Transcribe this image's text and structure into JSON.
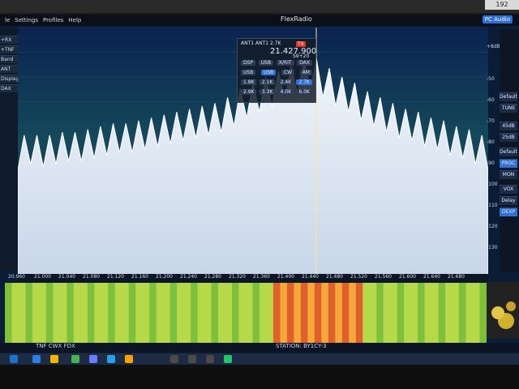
{
  "monitor_label": "192",
  "menu": {
    "file": "le",
    "settings": "Settings",
    "profiles": "Profiles",
    "help": "Help"
  },
  "brand": "FlexRadio",
  "pc_audio": "PC Audio",
  "left_side_buttons": [
    "+RX",
    "+TNF",
    "Band",
    "ANT",
    "Display",
    "DAX"
  ],
  "overlay": {
    "ant1": "ANT1",
    "ant2": "ANT1 2.7K",
    "tx": "TX",
    "frequency": "21.427.900",
    "s_meter": "S9+20",
    "rows": [
      [
        "DSP",
        "USB",
        "X/RIT",
        "DAX"
      ],
      [
        "USB",
        "USB",
        "CW",
        "AM"
      ],
      [
        "1.8K",
        "2.1K",
        "2.4K",
        "2.7K"
      ],
      [
        "2.9K",
        "3.3K",
        "4.0K",
        "6.0K"
      ]
    ]
  },
  "freq_ticks": [
    "20.960",
    "21.000",
    "21.040",
    "21.080",
    "21.120",
    "21.160",
    "21.200",
    "21.240",
    "21.280",
    "21.320",
    "21.360",
    "21.400",
    "21.440",
    "21.480",
    "21.520",
    "21.560",
    "21.600",
    "21.640",
    "21.680"
  ],
  "db_labels": [
    "+8dB",
    "-50",
    "-60",
    "-70",
    "-80",
    "-90",
    "-100",
    "-110",
    "-120",
    "-130"
  ],
  "right_panel": [
    "Default",
    "TUNE",
    "45dB",
    "25dB",
    "Default",
    "PROC",
    "MON",
    "VOX",
    "Delay",
    "DEXP"
  ],
  "status": {
    "left": "TNF CWX FDX",
    "station": "STATION: BY1CY-3"
  },
  "chart_data": {
    "type": "area",
    "x_label": "",
    "y_label": "",
    "x_range": [
      20.96,
      21.7
    ],
    "y_range": [
      -130,
      -45
    ],
    "x": [
      20.96,
      20.98,
      21.0,
      21.02,
      21.04,
      21.06,
      21.08,
      21.1,
      21.12,
      21.14,
      21.16,
      21.18,
      21.2,
      21.22,
      21.24,
      21.26,
      21.28,
      21.3,
      21.32,
      21.34,
      21.36,
      21.38,
      21.4,
      21.42,
      21.44,
      21.46,
      21.48,
      21.5,
      21.52,
      21.54,
      21.56,
      21.58,
      21.6,
      21.62,
      21.64,
      21.66,
      21.68,
      21.7
    ],
    "y": [
      -94,
      -92,
      -93,
      -92,
      -91,
      -91,
      -90,
      -89,
      -88,
      -88,
      -87,
      -86,
      -85,
      -84,
      -83,
      -82,
      -81,
      -79,
      -76,
      -74,
      -72,
      -70,
      -68,
      -66,
      -69,
      -72,
      -74,
      -77,
      -79,
      -81,
      -83,
      -84,
      -86,
      -87,
      -89,
      -90,
      -92,
      -94
    ]
  }
}
